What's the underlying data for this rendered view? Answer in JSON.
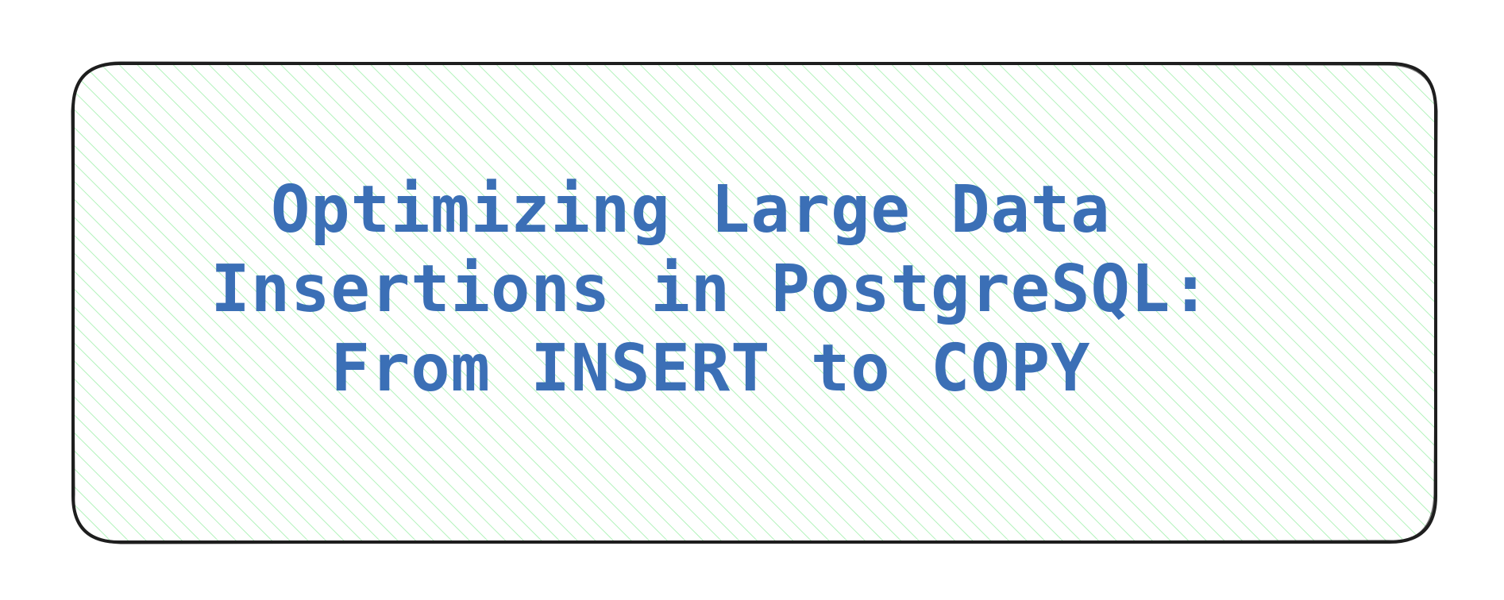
{
  "card": {
    "title_lines": [
      "Optimizing Large Data ",
      "Insertions in PostgreSQL:",
      "From INSERT to COPY"
    ]
  },
  "colors": {
    "background": "#ffffff",
    "card_border": "#1e1e1e",
    "hatch": "#b2f2bb",
    "title_text": "#3b6fb6"
  }
}
